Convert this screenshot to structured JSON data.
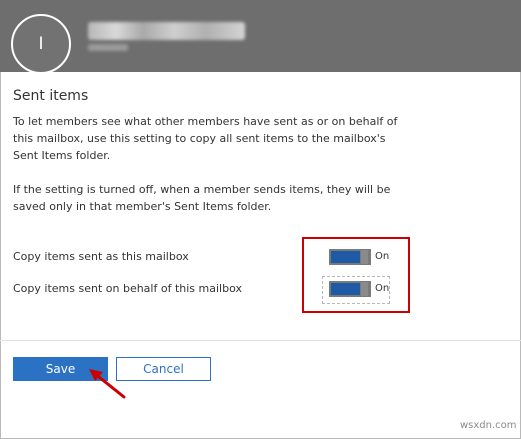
{
  "header": {
    "avatar_initial": "I",
    "username_redacted": "redacted account name"
  },
  "section": {
    "title": "Sent items",
    "paragraph1": "To let members see what other members have sent as or on behalf of this mailbox, use this setting to copy all sent items to the mailbox's Sent Items folder.",
    "paragraph2": "If the setting is turned off, when a member sends items, they will be saved only in that member's Sent Items folder."
  },
  "options": [
    {
      "label": "Copy items sent as this mailbox",
      "state": "On",
      "enabled": true
    },
    {
      "label": "Copy items sent on behalf of this mailbox",
      "state": "On",
      "enabled": true
    }
  ],
  "buttons": {
    "save": "Save",
    "cancel": "Cancel"
  },
  "colors": {
    "header_bg": "#6e6e6e",
    "toggle_on": "#1f5aa6",
    "primary": "#2b72c5",
    "annotation": "#cc0000"
  },
  "icons": {
    "annotation_arrow": "red-arrow-icon"
  },
  "watermark": "wsxdn.com"
}
